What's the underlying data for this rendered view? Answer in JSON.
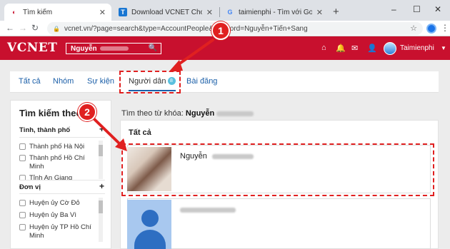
{
  "browser": {
    "tabs": [
      {
        "title": "Tìm kiếm",
        "favicon": "vcnet-favicon",
        "active": true
      },
      {
        "title": "Download VCNET Cho Android -",
        "favicon": "taimienphi-favicon",
        "active": false
      },
      {
        "title": "taimienphi - Tìm với Google",
        "favicon": "google-favicon",
        "active": false
      }
    ],
    "new_tab": "+",
    "window_controls": [
      "–",
      "☐",
      "✕"
    ],
    "url": "vcnet.vn/?page=search&type=AccountPeople&keyword=Nguyễn+Tiến+Sang"
  },
  "site": {
    "logo": "VCNET",
    "search_value": "Nguyễn",
    "user_name": "Taimienphi",
    "brand_color": "#c8102e"
  },
  "subtabs": [
    {
      "label": "Tất cả"
    },
    {
      "label": "Nhóm"
    },
    {
      "label": "Sự kiện"
    },
    {
      "label": "Người dân",
      "badge": "8",
      "active": true
    },
    {
      "label": "Bài đăng"
    }
  ],
  "filter": {
    "title": "Tìm kiếm theo",
    "groups": [
      {
        "label": "Tỉnh, thành phố",
        "items": [
          "Thành phố Hà Nội",
          "Thành phố Hồ Chí Minh",
          "Tỉnh An Giang"
        ]
      },
      {
        "label": "Đơn vị",
        "items": [
          "Huyện ủy Cờ Đỏ",
          "Huyện ủy Ba Vì",
          "Huyện ủy TP Hồ Chí Minh"
        ]
      }
    ]
  },
  "results": {
    "keyword_prefix": "Tìm theo từ khóa:",
    "keyword": "Nguyễn",
    "section_title": "Tất cả",
    "people": [
      {
        "name": "Nguyễn"
      },
      {
        "name": ""
      }
    ]
  },
  "annotations": {
    "step1": "1",
    "step2": "2",
    "color": "#e02020"
  }
}
